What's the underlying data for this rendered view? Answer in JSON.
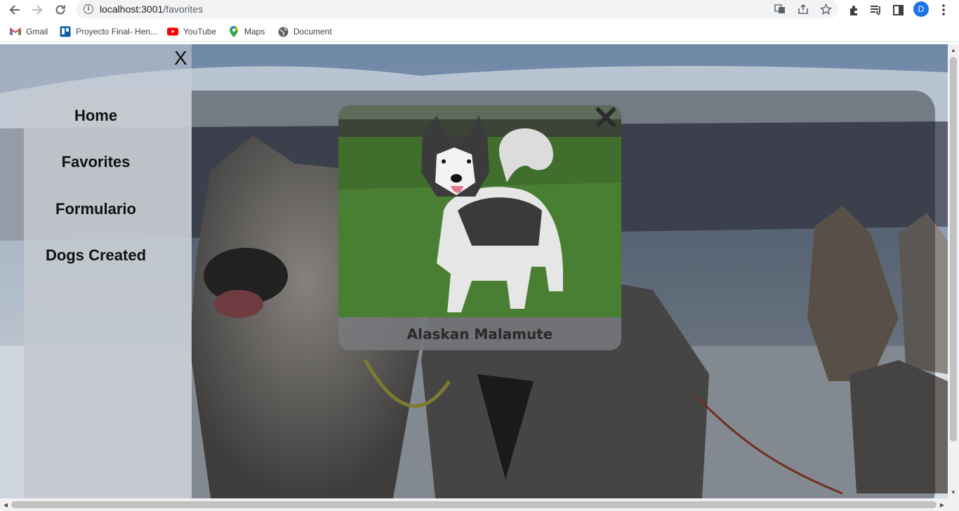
{
  "browser": {
    "url_host": "localhost:3001",
    "url_path": "/favorites",
    "profile_initial": "D",
    "bookmarks": [
      {
        "label": "Gmail",
        "icon": "gmail-icon"
      },
      {
        "label": "Proyecto Final- Hen...",
        "icon": "trello-icon"
      },
      {
        "label": "YouTube",
        "icon": "youtube-icon"
      },
      {
        "label": "Maps",
        "icon": "maps-icon"
      },
      {
        "label": "Document",
        "icon": "globe-icon"
      }
    ]
  },
  "sidebar": {
    "close_label": "X",
    "items": [
      {
        "label": "Home"
      },
      {
        "label": "Favorites"
      },
      {
        "label": "Formulario"
      },
      {
        "label": "Dogs Created"
      }
    ]
  },
  "favorite_card": {
    "title": "Alaskan Malamute",
    "close_icon": "close-x-icon"
  },
  "colors": {
    "accent_profile": "#1a73e8",
    "menu_text": "#111111",
    "overlay": "#14161a"
  }
}
